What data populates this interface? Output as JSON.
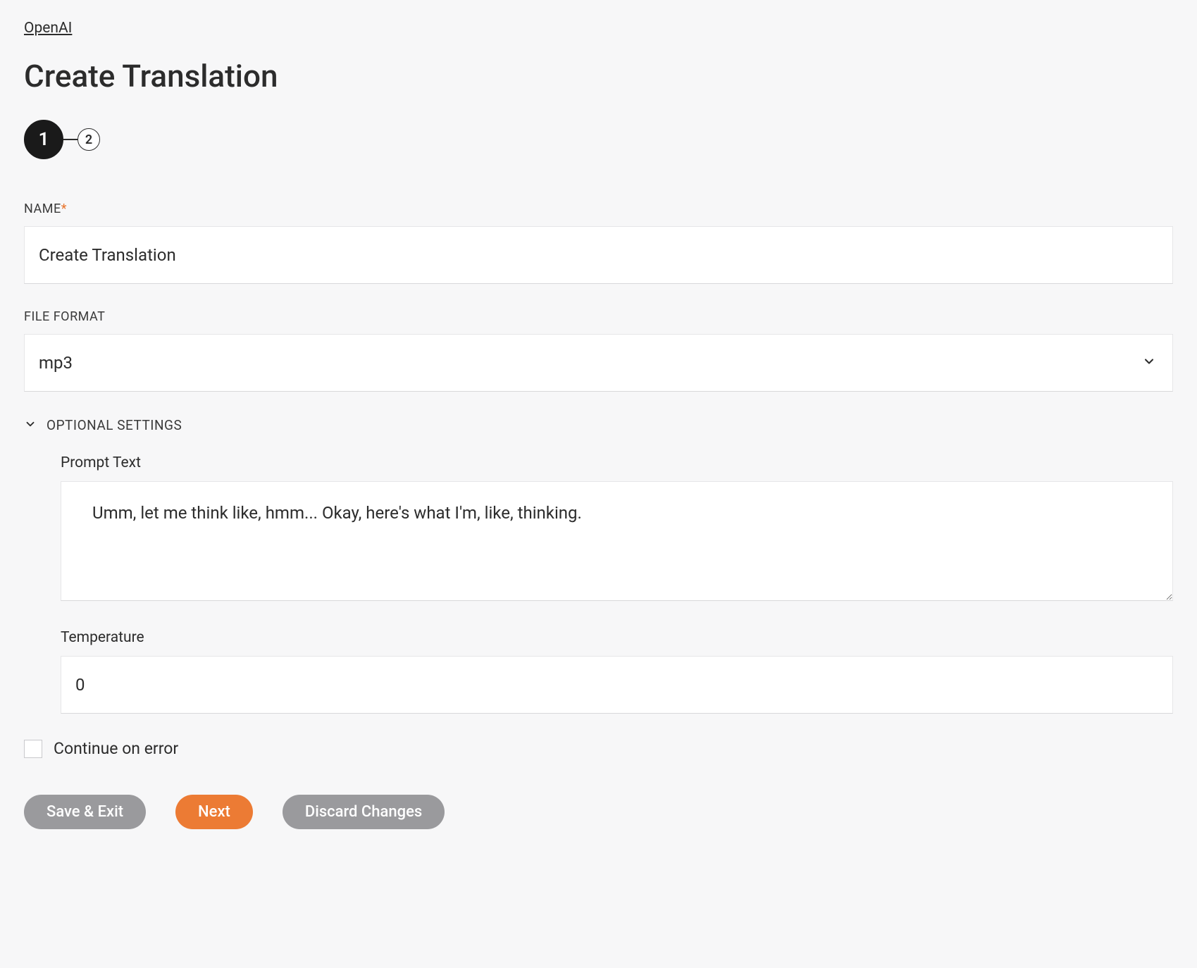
{
  "breadcrumb": {
    "label": "OpenAI"
  },
  "page": {
    "title": "Create Translation"
  },
  "stepper": {
    "steps": [
      "1",
      "2"
    ],
    "active_index": 0
  },
  "fields": {
    "name": {
      "label": "NAME",
      "required_mark": "*",
      "value": "Create Translation"
    },
    "file_format": {
      "label": "FILE FORMAT",
      "value": "mp3"
    },
    "optional": {
      "header": "OPTIONAL SETTINGS"
    },
    "prompt_text": {
      "label": "Prompt Text",
      "value": "Umm, let me think like, hmm... Okay, here's what I'm, like, thinking."
    },
    "temperature": {
      "label": "Temperature",
      "value": "0"
    },
    "continue_on_error": {
      "label": "Continue on error",
      "checked": false
    }
  },
  "buttons": {
    "save_exit": "Save & Exit",
    "next": "Next",
    "discard": "Discard Changes"
  }
}
